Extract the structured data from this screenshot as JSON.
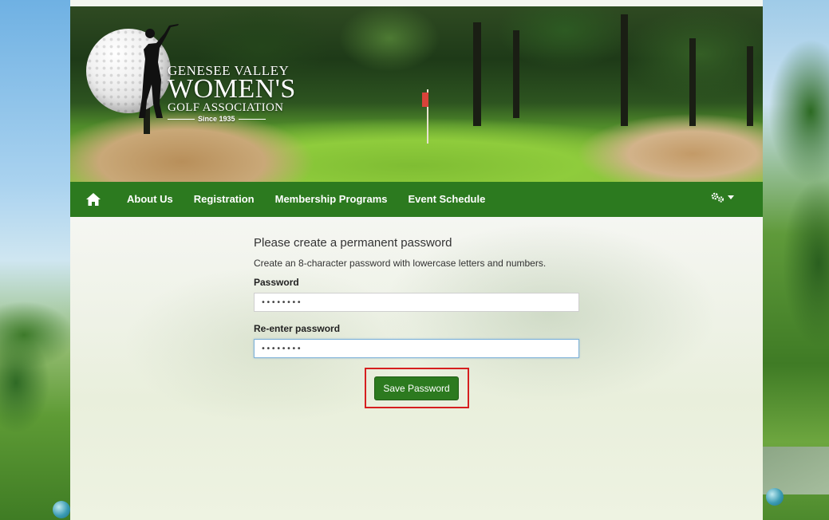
{
  "logo": {
    "line1": "GENESEE VALLEY",
    "line2": "WOMEN'S",
    "line3": "GOLF ASSOCIATION",
    "since": "Since 1935"
  },
  "nav": {
    "home_icon": "home-icon",
    "items": [
      {
        "label": "About Us"
      },
      {
        "label": "Registration"
      },
      {
        "label": "Membership Programs"
      },
      {
        "label": "Event Schedule"
      }
    ],
    "settings_icon": "gears-icon"
  },
  "form": {
    "title": "Please create a permanent password",
    "description": "Create an 8-character password with lowercase letters and numbers.",
    "password_label": "Password",
    "password_value": "••••••••",
    "reenter_label": "Re-enter password",
    "reenter_value": "••••••••",
    "save_label": "Save Password"
  },
  "colors": {
    "nav_green": "#2c7a1f",
    "highlight": "#d61f1f"
  }
}
